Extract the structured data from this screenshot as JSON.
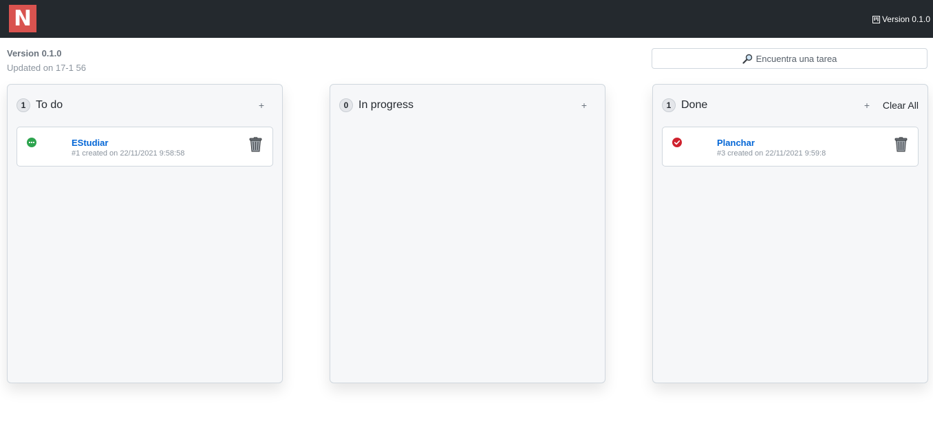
{
  "app": {
    "logo_letter": "N",
    "header_version": "Version 0.1.0",
    "version": "Version 0.1.0",
    "updated": "Updated on 17-1 56"
  },
  "search": {
    "placeholder": "Encuentra una tarea"
  },
  "columns": [
    {
      "count": "1",
      "title": "To do",
      "add_label": "+",
      "cards": [
        {
          "title": "EStudiar",
          "subtitle": "#1 created on 22/11/2021 9:58:58",
          "status_icon": "open-dots-icon",
          "status_color": "#2da44e"
        }
      ]
    },
    {
      "count": "0",
      "title": "In progress",
      "add_label": "+",
      "cards": []
    },
    {
      "count": "1",
      "title": "Done",
      "add_label": "+",
      "clear_label": "Clear All",
      "cards": [
        {
          "title": "Planchar",
          "subtitle": "#3 created on 22/11/2021 9:59:8",
          "status_icon": "done-check-icon",
          "status_color": "#cf222e"
        }
      ]
    }
  ],
  "colors": {
    "topbar": "#24292e",
    "logo": "#d9534f",
    "link": "#0366d6"
  }
}
